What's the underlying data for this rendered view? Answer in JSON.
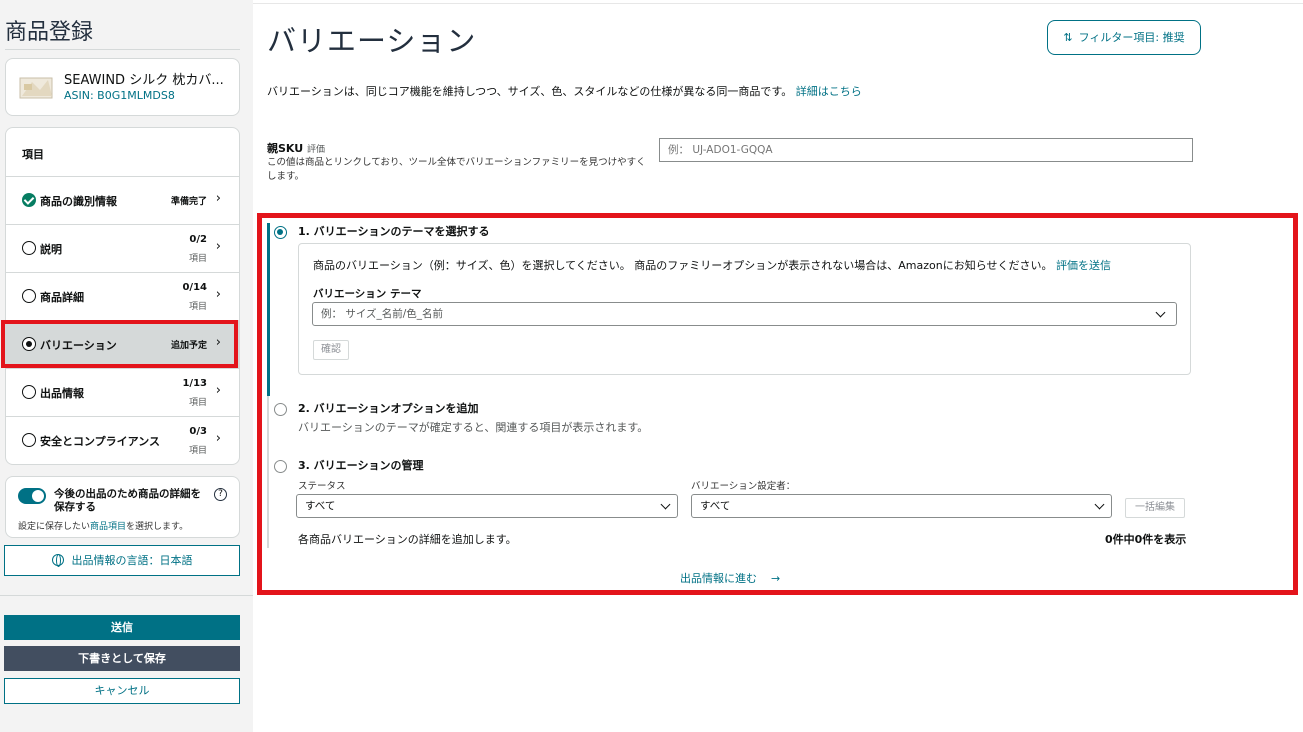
{
  "sidebar": {
    "title": "商品登録",
    "product": {
      "name": "SEAWIND シルク 枕カバ...",
      "asin": "ASIN: B0G1MLMDS8"
    },
    "nav_header": "項目",
    "items": [
      {
        "label": "商品の識別情報",
        "status": "準備完了",
        "icon": "check-circle-icon"
      },
      {
        "label": "説明",
        "count": "0/2",
        "unit": "項目",
        "icon": "radio-empty-icon"
      },
      {
        "label": "商品詳細",
        "count": "0/14",
        "unit": "項目",
        "icon": "radio-empty-icon"
      },
      {
        "label": "バリエーション",
        "status": "追加予定",
        "icon": "radio-selected-icon"
      },
      {
        "label": "出品情報",
        "count": "1/13",
        "unit": "項目",
        "icon": "radio-empty-icon"
      },
      {
        "label": "安全とコンプライアンス",
        "count": "0/3",
        "unit": "項目",
        "icon": "radio-empty-icon"
      }
    ],
    "save_details": {
      "title": "今後の出品のため商品の詳細を保存する",
      "help": "?",
      "desc_prefix": "設定に保存したい",
      "desc_link": "商品項目",
      "desc_suffix": "を選択します。"
    },
    "language_button": "出品情報の言語：日本語",
    "submit": "送信",
    "save_draft": "下書きとして保存",
    "cancel": "キャンセル"
  },
  "main": {
    "title": "バリエーション",
    "filter_button": "フィルター項目: 推奨",
    "intro": "バリエーションは、同じコア機能を維持しつつ、サイズ、色、スタイルなどの仕様が異なる同一商品です。",
    "intro_link": "詳細はこちら",
    "parent_sku": {
      "label": "親SKU",
      "sub": "評価",
      "desc": "この値は商品とリンクしており、ツール全体でバリエーションファミリーを見つけやすくします。",
      "placeholder": "例： UJ-ADO1-GQQA"
    },
    "step1": {
      "title": "1. バリエーションのテーマを選択する",
      "desc": "商品のバリエーション（例：サイズ、色）を選択してください。 商品のファミリーオプションが表示されない場合は、Amazonにお知らせください。",
      "desc_link": "評価を送信",
      "theme_label": "バリエーション テーマ",
      "theme_placeholder": "例： サイズ_名前/色_名前",
      "confirm": "確認"
    },
    "step2": {
      "title": "2. バリエーションオプションを追加",
      "desc": "バリエーションのテーマが確定すると、関連する項目が表示されます。"
    },
    "step3": {
      "title": "3. バリエーションの管理",
      "status_label": "ステータス",
      "status_value": "すべて",
      "setter_label": "バリエーション設定者：",
      "setter_value": "すべて",
      "bulk_edit": "一括編集",
      "each_desc": "各商品バリエーションの詳細を追加します。",
      "count": "0件中0件を表示"
    },
    "next_link": "出品情報に進む",
    "next_arrow": "→"
  },
  "colors": {
    "accent": "#007185",
    "highlight": "#e3141b",
    "success": "#067d62"
  }
}
